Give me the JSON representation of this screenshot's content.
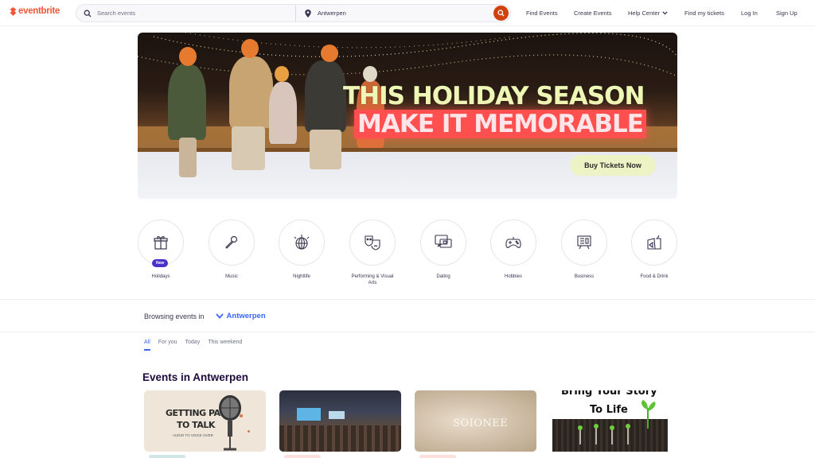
{
  "header": {
    "logo_text": "eventbrite",
    "search_placeholder": "Search events",
    "location_value": "Antwerpen",
    "nav": {
      "find_events": "Find Events",
      "create_events": "Create Events",
      "help_center": "Help Center",
      "find_tickets": "Find my tickets",
      "login": "Log In",
      "signup": "Sign Up"
    }
  },
  "hero": {
    "line1": "THIS HOLIDAY SEASON",
    "line2": "MAKE IT MEMORABLE",
    "cta": "Buy Tickets Now"
  },
  "categories": [
    {
      "label": "Holidays",
      "icon": "gift-icon",
      "badge": "New"
    },
    {
      "label": "Music",
      "icon": "microphone-icon"
    },
    {
      "label": "Nightlife",
      "icon": "disco-ball-icon"
    },
    {
      "label": "Performing & Visual Arts",
      "icon": "theater-masks-icon"
    },
    {
      "label": "Dating",
      "icon": "chat-heart-icon"
    },
    {
      "label": "Hobbies",
      "icon": "gamepad-icon"
    },
    {
      "label": "Business",
      "icon": "presentation-icon"
    },
    {
      "label": "Food & Drink",
      "icon": "food-drink-icon"
    }
  ],
  "browsing": {
    "label": "Browsing events in",
    "location": "Antwerpen"
  },
  "tabs": [
    "All",
    "For you",
    "Today",
    "This weekend"
  ],
  "section_title": "Events in Antwerpen",
  "cards": [
    {
      "line1": "GETTING PAID",
      "line2": "TO TALK",
      "sub": "AUDIO TO VOICE OVER"
    },
    {
      "alt": "conference-photo"
    },
    {
      "brand": "SOIONEE"
    },
    {
      "line1": "Bring Your Story",
      "line2": "To Life"
    }
  ],
  "colors": {
    "brand": "#f05537",
    "search_button": "#d1410c",
    "accent_blue": "#3d64ff",
    "badge_purple": "#4a2fc8"
  }
}
